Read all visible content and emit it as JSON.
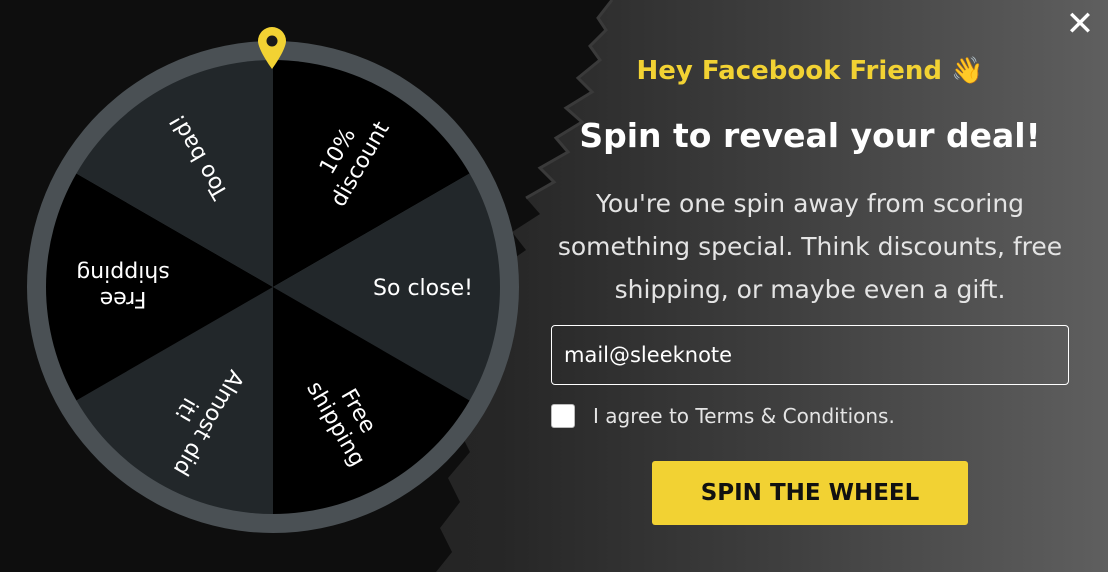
{
  "colors": {
    "accent_yellow": "#f2d233",
    "wheel_rim": "#4a5054",
    "segment_dark": "#22272a",
    "segment_black": "#000000",
    "text_white": "#ffffff"
  },
  "close": {
    "icon": "close-icon",
    "glyph": "✕"
  },
  "wheel": {
    "pointer_icon": "map-pin-icon",
    "segments": [
      {
        "label": "10%\ndiscount",
        "color": "#000000"
      },
      {
        "label": "So close!",
        "color": "#22272a"
      },
      {
        "label": "Free\nshipping",
        "color": "#000000"
      },
      {
        "label": "Almost did\nit!",
        "color": "#22272a"
      },
      {
        "label": "Free\nshipping",
        "color": "#000000"
      },
      {
        "label": "Too bad!",
        "color": "#22272a"
      }
    ]
  },
  "greeting": {
    "text": "Hey Facebook Friend",
    "emoji": "👋"
  },
  "headline": "Spin to reveal your deal!",
  "subtext": "You're one spin away from scoring something special. Think discounts, free shipping, or maybe even a gift.",
  "email": {
    "value": "mail@sleeknote",
    "placeholder": ""
  },
  "terms": {
    "label": "I agree to Terms & Conditions.",
    "checked": false
  },
  "cta": {
    "label": "SPIN THE WHEEL"
  }
}
